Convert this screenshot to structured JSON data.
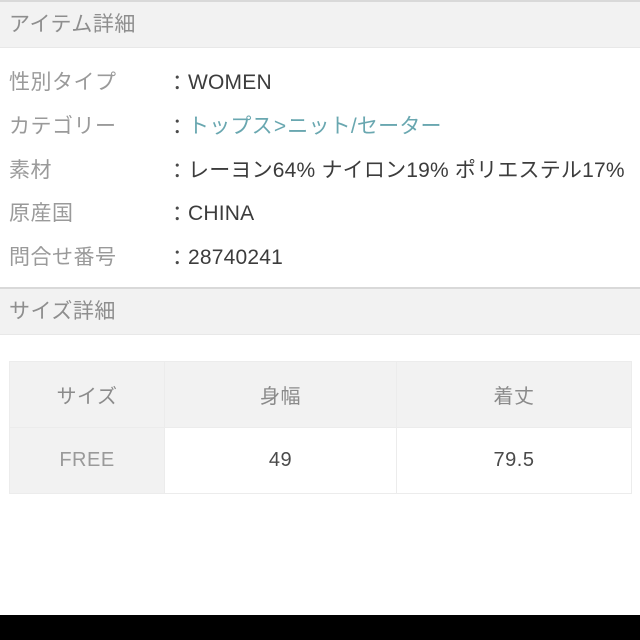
{
  "item_details": {
    "section_title": "アイテム詳細",
    "rows": [
      {
        "label": "性別タイプ",
        "colon": "：",
        "value": "WOMEN",
        "is_link": false
      },
      {
        "label": "カテゴリー",
        "colon": "：",
        "value": "トップス > ニット/セーター",
        "value_parts": {
          "parent": "トップス",
          "separator": ">",
          "child": "ニット/セーター"
        },
        "is_link": true
      },
      {
        "label": "素材",
        "colon": "：",
        "value": "レーヨン64% ナイロン19% ポリエステル17%",
        "is_link": false
      },
      {
        "label": "原産国",
        "colon": "：",
        "value": "CHINA",
        "is_link": false
      },
      {
        "label": "問合せ番号",
        "colon": "：",
        "value": "28740241",
        "is_link": false
      }
    ]
  },
  "size_details": {
    "section_title": "サイズ詳細",
    "table": {
      "headers": [
        "サイズ",
        "身幅",
        "着丈"
      ],
      "rows": [
        [
          "FREE",
          "49",
          "79.5"
        ]
      ]
    }
  },
  "colors": {
    "banner_background": "#f2f2f2",
    "banner_title": "#8e8e8e",
    "label_text": "#9a9a9a",
    "value_text": "#3c3c3c",
    "link_text": "#69a7b0",
    "table_border": "#ececec",
    "table_header_background": "#f2f2f2",
    "page_background": "#ffffff",
    "bottom_bar": "#000000"
  }
}
